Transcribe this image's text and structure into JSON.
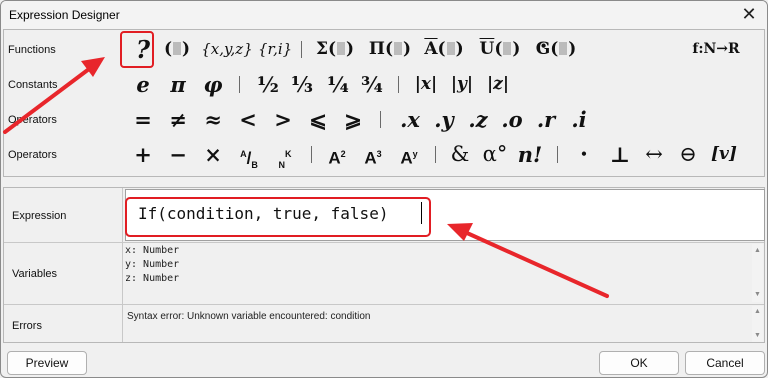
{
  "window": {
    "title": "Expression Designer",
    "close_glyph": "✕"
  },
  "palette": {
    "rows": [
      {
        "label": "Functions",
        "symbols": [
          {
            "name": "question-function",
            "text": "?"
          },
          {
            "name": "paren-function",
            "text": "(▯)"
          },
          {
            "name": "vector-xyz-function",
            "text": "{x,y,z}"
          },
          {
            "name": "polar-function",
            "text": "{r,i}"
          },
          {
            "name": "sum-function",
            "text": "Σ"
          },
          {
            "name": "product-function",
            "text": "Π"
          },
          {
            "name": "overline-a-function",
            "text": "A"
          },
          {
            "name": "overline-u-function",
            "text": "U"
          },
          {
            "name": "dot-g-function",
            "text": "G"
          },
          {
            "name": "function-map",
            "text": "f:N→R"
          }
        ]
      },
      {
        "label": "Constants",
        "symbols": [
          {
            "name": "e-constant",
            "text": "e"
          },
          {
            "name": "pi-constant",
            "text": "π"
          },
          {
            "name": "phi-constant",
            "text": "φ"
          },
          {
            "name": "half-constant",
            "text": "½"
          },
          {
            "name": "third-constant",
            "text": "⅓"
          },
          {
            "name": "quarter-constant",
            "text": "¼"
          },
          {
            "name": "three-quarters-constant",
            "text": "¾"
          },
          {
            "name": "abs-x-constant",
            "text": "|x|"
          },
          {
            "name": "abs-y-constant",
            "text": "|y|"
          },
          {
            "name": "abs-z-constant",
            "text": "|z|"
          }
        ]
      },
      {
        "label": "Operators",
        "symbols": [
          {
            "name": "equals-operator",
            "text": "="
          },
          {
            "name": "not-equal-operator",
            "text": "≠"
          },
          {
            "name": "approx-operator",
            "text": "≈"
          },
          {
            "name": "less-than-operator",
            "text": "<"
          },
          {
            "name": "greater-than-operator",
            "text": ">"
          },
          {
            "name": "less-equal-operator",
            "text": "⩽"
          },
          {
            "name": "greater-equal-operator",
            "text": "⩾"
          },
          {
            "name": "dot-x-operator",
            "text": ".x"
          },
          {
            "name": "dot-y-operator",
            "text": ".y"
          },
          {
            "name": "dot-z-operator",
            "text": ".z"
          },
          {
            "name": "dot-o-operator",
            "text": ".o"
          },
          {
            "name": "dot-r-operator",
            "text": ".r"
          },
          {
            "name": "dot-i-operator",
            "text": ".i"
          }
        ]
      },
      {
        "label": "Operators",
        "symbols": [
          {
            "name": "plus-operator",
            "text": "+"
          },
          {
            "name": "minus-operator",
            "text": "−"
          },
          {
            "name": "times-operator",
            "text": "×"
          },
          {
            "name": "fraction-operator",
            "text": "A/B"
          },
          {
            "name": "binomial-operator",
            "text": "NK"
          },
          {
            "name": "square-operator",
            "text": "A²"
          },
          {
            "name": "cube-operator",
            "text": "A³"
          },
          {
            "name": "power-operator",
            "text": "Aʸ"
          },
          {
            "name": "and-operator",
            "text": "&"
          },
          {
            "name": "degree-operator",
            "text": "α°"
          },
          {
            "name": "factorial-operator",
            "text": "n!"
          },
          {
            "name": "dot-product-operator",
            "text": "•"
          },
          {
            "name": "perpendicular-operator",
            "text": "⊥"
          },
          {
            "name": "double-arrow-operator",
            "text": "↔"
          },
          {
            "name": "circle-minus-operator",
            "text": "⊖"
          },
          {
            "name": "vector-v-operator",
            "text": "[v]"
          }
        ]
      }
    ]
  },
  "expression": {
    "label": "Expression",
    "value": "If(condition, true, false)"
  },
  "variables": {
    "label": "Variables",
    "lines": [
      "x: Number",
      "y: Number",
      "z: Number"
    ]
  },
  "errors": {
    "label": "Errors",
    "message": "Syntax error: Unknown variable encountered: condition"
  },
  "buttons": {
    "preview": "Preview",
    "ok": "OK",
    "cancel": "Cancel"
  },
  "colors": {
    "highlight": "#e11d23"
  }
}
